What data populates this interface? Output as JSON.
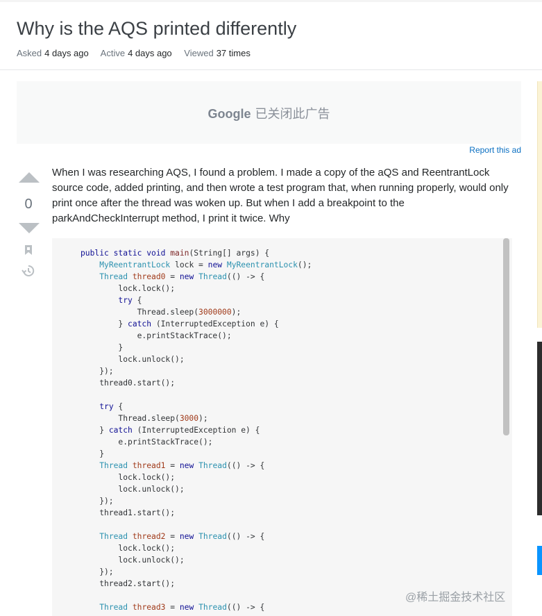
{
  "question": {
    "title": "Why is the AQS printed differently",
    "asked_label": "Asked",
    "asked_value": "4 days ago",
    "active_label": "Active",
    "active_value": "4 days ago",
    "viewed_label": "Viewed",
    "viewed_value": "37 times"
  },
  "ad": {
    "brand": "Google",
    "message": "已关闭此广告",
    "report_link": "Report this ad"
  },
  "vote": {
    "count": "0"
  },
  "post": {
    "body": "When I was researching AQS, I found a problem. I made a copy of the aQS and ReentrantLock source code, added printing, and then wrote a test program that, when running properly, would only print once after the thread was woken up. But when I add a breakpoint to the parkAndCheckInterrupt method, I print it twice. Why"
  },
  "code": {
    "lines": [
      "public static void main(String[] args) {",
      "    MyReentrantLock lock = new MyReentrantLock();",
      "    Thread thread0 = new Thread(() -> {",
      "        lock.lock();",
      "        try {",
      "            Thread.sleep(3000000);",
      "        } catch (InterruptedException e) {",
      "            e.printStackTrace();",
      "        }",
      "        lock.unlock();",
      "    });",
      "    thread0.start();",
      "",
      "    try {",
      "        Thread.sleep(3000);",
      "    } catch (InterruptedException e) {",
      "        e.printStackTrace();",
      "    }",
      "    Thread thread1 = new Thread(() -> {",
      "        lock.lock();",
      "        lock.unlock();",
      "    });",
      "    thread1.start();",
      "",
      "    Thread thread2 = new Thread(() -> {",
      "        lock.lock();",
      "        lock.unlock();",
      "    });",
      "    thread2.start();",
      "",
      "    Thread thread3 = new Thread(() -> {"
    ]
  },
  "watermark": "@稀土掘金技术社区",
  "colors": {
    "link": "#0a6fc2",
    "code_bg": "#f6f6f6",
    "keyword": "#101094",
    "type": "#2b91af"
  }
}
